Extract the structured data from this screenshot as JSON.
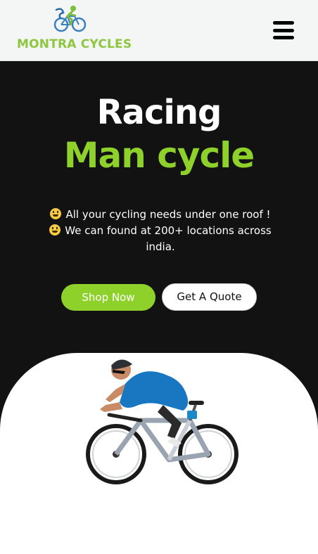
{
  "header": {
    "brand": "MONTRA CYCLES",
    "logo_icon": "cyclist-logo-icon",
    "menu_icon": "hamburger-menu-icon"
  },
  "hero": {
    "title_line1": "Racing",
    "title_line2": "Man cycle",
    "tagline_line1": "All your cycling needs under one roof !",
    "tagline_line2": "We can found at 200+ locations across india.",
    "emoji_icon": "grinning-face-icon",
    "shop_button": "Shop Now",
    "quote_button": "Get A Quote",
    "image": "racing-cyclist-photo"
  },
  "colors": {
    "accent": "#8ed12a",
    "background": "#121212",
    "header_bg": "#f4f5f5"
  }
}
